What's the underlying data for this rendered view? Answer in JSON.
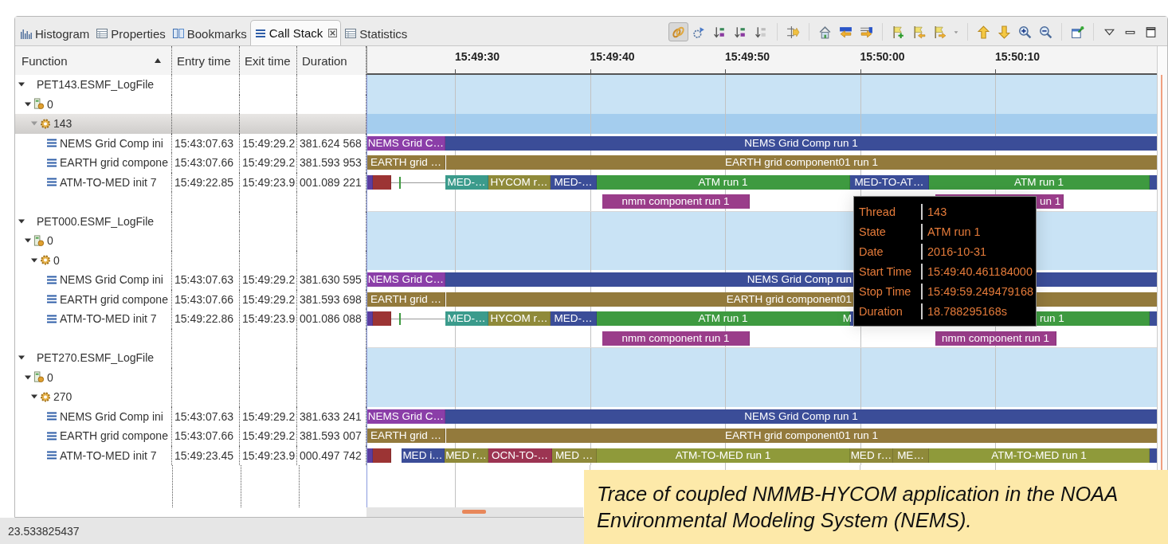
{
  "tabs": [
    {
      "label": "Histogram",
      "selected": false
    },
    {
      "label": "Properties",
      "selected": false
    },
    {
      "label": "Bookmarks",
      "selected": false
    },
    {
      "label": "Call Stack",
      "selected": true
    },
    {
      "label": "Statistics",
      "selected": false
    }
  ],
  "toolbar": {
    "link_pressed": true
  },
  "table": {
    "columns": [
      {
        "label": "Function",
        "sorted": true
      },
      {
        "label": "Entry time"
      },
      {
        "label": "Exit time"
      },
      {
        "label": "Duration"
      }
    ]
  },
  "timeline": {
    "ticks": [
      "15:49:30",
      "15:49:40",
      "15:49:50",
      "15:50:00",
      "15:50:10"
    ]
  },
  "tree": [
    {
      "kind": "trace",
      "name": "PET143.ESMF_LogFile",
      "expanded": true,
      "children": [
        {
          "kind": "process",
          "name": "0",
          "expanded": true,
          "children": [
            {
              "kind": "thread",
              "name": "143",
              "expanded": true,
              "selected": true,
              "children": [
                {
                  "kind": "function",
                  "name": "NEMS Grid Comp ini",
                  "entry": "15:43:07.63",
                  "exit": "15:49:29.2",
                  "duration": "381.624 568",
                  "events": [
                    {
                      "kind": "bar",
                      "label": "NEMS Grid C…",
                      "color": "#8b3ea8"
                    },
                    {
                      "kind": "bar",
                      "label": "NEMS Grid Comp run 1",
                      "color": "#3b4d98"
                    }
                  ]
                },
                {
                  "kind": "function",
                  "name": "EARTH grid compone",
                  "entry": "15:43:07.66",
                  "exit": "15:49:29.2",
                  "duration": "381.593 953",
                  "events": [
                    {
                      "kind": "bar",
                      "label": "EARTH grid …",
                      "color": "#937a3c"
                    },
                    {
                      "kind": "bar",
                      "label": "EARTH grid component01 run 1",
                      "color": "#937a3c"
                    }
                  ]
                },
                {
                  "kind": "function",
                  "name": "ATM-TO-MED init 7",
                  "entry": "15:49:22.85",
                  "exit": "15:49:23.9",
                  "duration": "001.089 221",
                  "events": [
                    {
                      "kind": "bar",
                      "color": "#5c3ea0"
                    },
                    {
                      "kind": "bar",
                      "color": "#9c3434"
                    },
                    {
                      "kind": "line",
                      "color": "#9a9a9a"
                    },
                    {
                      "kind": "mark",
                      "color": "#3e9a40"
                    },
                    {
                      "kind": "bar",
                      "label": "MED-…",
                      "color": "#3b9b8c"
                    },
                    {
                      "kind": "bar",
                      "label": "HYCOM r…",
                      "color": "#8f8a3a"
                    },
                    {
                      "kind": "bar",
                      "label": "MED-…",
                      "color": "#3b4d98"
                    },
                    {
                      "kind": "bar",
                      "label": "ATM run 1",
                      "color": "#3e9a40"
                    },
                    {
                      "kind": "bar",
                      "label": "MED-TO-AT…",
                      "color": "#3b4d98"
                    },
                    {
                      "kind": "bar",
                      "label": "ATM run 1",
                      "color": "#3e9a40"
                    },
                    {
                      "kind": "bar",
                      "color": "#3b4d98"
                    }
                  ]
                },
                {
                  "kind": "lane",
                  "events": [
                    {
                      "kind": "bar",
                      "label": "nmm component run 1",
                      "color": "#9a3d8a"
                    },
                    {
                      "kind": "bar",
                      "label": "un 1",
                      "color": "#9a3d8a"
                    }
                  ]
                }
              ]
            }
          ]
        }
      ]
    },
    {
      "kind": "trace",
      "name": "PET000.ESMF_LogFile",
      "expanded": true,
      "children": [
        {
          "kind": "process",
          "name": "0",
          "expanded": true,
          "children": [
            {
              "kind": "thread",
              "name": "0",
              "expanded": true,
              "selected": false,
              "children": [
                {
                  "kind": "function",
                  "name": "NEMS Grid Comp ini",
                  "entry": "15:43:07.63",
                  "exit": "15:49:29.2",
                  "duration": "381.630 595",
                  "events": [
                    {
                      "kind": "bar",
                      "label": "NEMS Grid C…",
                      "color": "#8b3ea8"
                    },
                    {
                      "kind": "bar",
                      "label": "NEMS Grid Comp run",
                      "color": "#3b4d98"
                    }
                  ]
                },
                {
                  "kind": "function",
                  "name": "EARTH grid compone",
                  "entry": "15:43:07.66",
                  "exit": "15:49:29.2",
                  "duration": "381.593 698",
                  "events": [
                    {
                      "kind": "bar",
                      "label": "EARTH grid …",
                      "color": "#937a3c"
                    },
                    {
                      "kind": "bar",
                      "label": "EARTH grid component01",
                      "color": "#937a3c"
                    }
                  ]
                },
                {
                  "kind": "function",
                  "name": "ATM-TO-MED init 7",
                  "entry": "15:49:22.86",
                  "exit": "15:49:23.9",
                  "duration": "001.086 088",
                  "events": [
                    {
                      "kind": "bar",
                      "color": "#5c3ea0"
                    },
                    {
                      "kind": "bar",
                      "color": "#9c3434"
                    },
                    {
                      "kind": "line",
                      "color": "#9a9a9a"
                    },
                    {
                      "kind": "mark",
                      "color": "#3e9a40"
                    },
                    {
                      "kind": "bar",
                      "label": "MED-…",
                      "color": "#3b9b8c"
                    },
                    {
                      "kind": "bar",
                      "label": "HYCOM r…",
                      "color": "#8f8a3a"
                    },
                    {
                      "kind": "bar",
                      "label": "MED-…",
                      "color": "#3b4d98"
                    },
                    {
                      "kind": "bar",
                      "label": "ATM run 1",
                      "color": "#3e9a40"
                    },
                    {
                      "kind": "bar",
                      "label": "M",
                      "color": "#3b4d98"
                    },
                    {
                      "kind": "bar",
                      "label": "run 1",
                      "color": "#3e9a40"
                    },
                    {
                      "kind": "bar",
                      "color": "#3b4d98"
                    }
                  ]
                },
                {
                  "kind": "lane",
                  "events": [
                    {
                      "kind": "bar",
                      "label": "nmm component run 1",
                      "color": "#9a3d8a"
                    },
                    {
                      "kind": "bar",
                      "label": "nmm component run 1",
                      "color": "#9a3d8a"
                    }
                  ]
                }
              ]
            }
          ]
        }
      ]
    },
    {
      "kind": "trace",
      "name": "PET270.ESMF_LogFile",
      "expanded": true,
      "children": [
        {
          "kind": "process",
          "name": "0",
          "expanded": true,
          "children": [
            {
              "kind": "thread",
              "name": "270",
              "expanded": true,
              "selected": false,
              "children": [
                {
                  "kind": "function",
                  "name": "NEMS Grid Comp ini",
                  "entry": "15:43:07.63",
                  "exit": "15:49:29.2",
                  "duration": "381.633 241",
                  "events": [
                    {
                      "kind": "bar",
                      "label": "NEMS Grid C…",
                      "color": "#8b3ea8"
                    },
                    {
                      "kind": "bar",
                      "label": "NEMS Grid Comp run 1",
                      "color": "#3b4d98"
                    }
                  ]
                },
                {
                  "kind": "function",
                  "name": "EARTH grid compone",
                  "entry": "15:43:07.66",
                  "exit": "15:49:29.2",
                  "duration": "381.593 007",
                  "events": [
                    {
                      "kind": "bar",
                      "label": "EARTH grid …",
                      "color": "#937a3c"
                    },
                    {
                      "kind": "bar",
                      "label": "EARTH grid component01 run 1",
                      "color": "#937a3c"
                    }
                  ]
                },
                {
                  "kind": "function",
                  "name": "ATM-TO-MED init 7",
                  "entry": "15:49:23.45",
                  "exit": "15:49:23.9",
                  "duration": "000.497 742",
                  "events": [
                    {
                      "kind": "bar",
                      "color": "#5c3ea0"
                    },
                    {
                      "kind": "bar",
                      "color": "#9c3434"
                    },
                    {
                      "kind": "bar",
                      "label": "MED i…",
                      "color": "#3b4d98"
                    },
                    {
                      "kind": "bar",
                      "label": "MED r…",
                      "color": "#8f8a3a"
                    },
                    {
                      "kind": "bar",
                      "label": "OCN-TO-…",
                      "color": "#9c3452"
                    },
                    {
                      "kind": "bar",
                      "label": "MED …",
                      "color": "#8f8a3a"
                    },
                    {
                      "kind": "bar",
                      "label": "ATM-TO-MED run 1",
                      "color": "#8f9a3a"
                    },
                    {
                      "kind": "bar",
                      "label": "MED r…",
                      "color": "#8f8a3a"
                    },
                    {
                      "kind": "bar",
                      "label": "ME…",
                      "color": "#8f8a3a"
                    },
                    {
                      "kind": "bar",
                      "label": "ATM-TO-MED run 1",
                      "color": "#8f9a3a"
                    },
                    {
                      "kind": "bar",
                      "color": "#3b4d98"
                    }
                  ]
                }
              ]
            }
          ]
        }
      ]
    }
  ],
  "tooltip": {
    "rows": [
      {
        "label": "Thread",
        "value": "143"
      },
      {
        "label": "State",
        "value": "ATM run 1"
      },
      {
        "label": "Date",
        "value": "2016-10-31"
      },
      {
        "label": "Start Time",
        "value": "15:49:40.461184000"
      },
      {
        "label": "Stop Time",
        "value": "15:49:59.249479168"
      },
      {
        "label": "Duration",
        "value": "18.788295168s"
      }
    ]
  },
  "status_bar": "23.533825437",
  "caption": "Trace of coupled NMMB-HYCOM application in the NOAA Environmental Modeling System (NEMS)."
}
